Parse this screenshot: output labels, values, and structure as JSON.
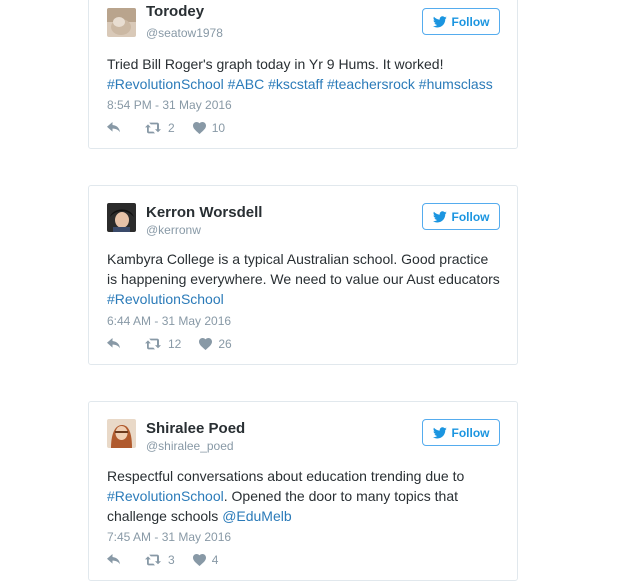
{
  "follow_label": "Follow",
  "tweets": [
    {
      "name": "Torodey",
      "handle": "@seatow1978",
      "text_pre": "Tried Bill Roger's graph today in Yr 9 Hums. It worked! ",
      "text_link1": "#RevolutionSchool #ABC #kscstaff #teachersrock #humsclass",
      "text_mid": "",
      "text_link2": "",
      "timestamp": "8:54 PM - 31 May 2016",
      "retweets": "2",
      "likes": "10"
    },
    {
      "name": "Kerron Worsdell",
      "handle": "@kerronw",
      "text_pre": "Kambyra College is a typical Australian school. Good practice is happening everywhere. We need to value our Aust educators ",
      "text_link1": "#RevolutionSchool",
      "text_mid": "",
      "text_link2": "",
      "timestamp": "6:44 AM - 31 May 2016",
      "retweets": "12",
      "likes": "26"
    },
    {
      "name": "Shiralee Poed",
      "handle": "@shiralee_poed",
      "text_pre": "Respectful conversations about education trending due to ",
      "text_link1": "#RevolutionSchool",
      "text_mid": ". Opened the door to many topics that challenge schools ",
      "text_link2": "@EduMelb",
      "timestamp": "7:45 AM - 31 May 2016",
      "retweets": "3",
      "likes": "4"
    }
  ],
  "colors": {
    "link": "#2b7bb9",
    "follow_blue": "#1b95e0",
    "meta_gray": "#8899a6",
    "text": "#292f33",
    "border": "#e1e8ed"
  },
  "icons": [
    "twitter-bird-icon",
    "reply-icon",
    "retweet-icon",
    "heart-icon"
  ]
}
